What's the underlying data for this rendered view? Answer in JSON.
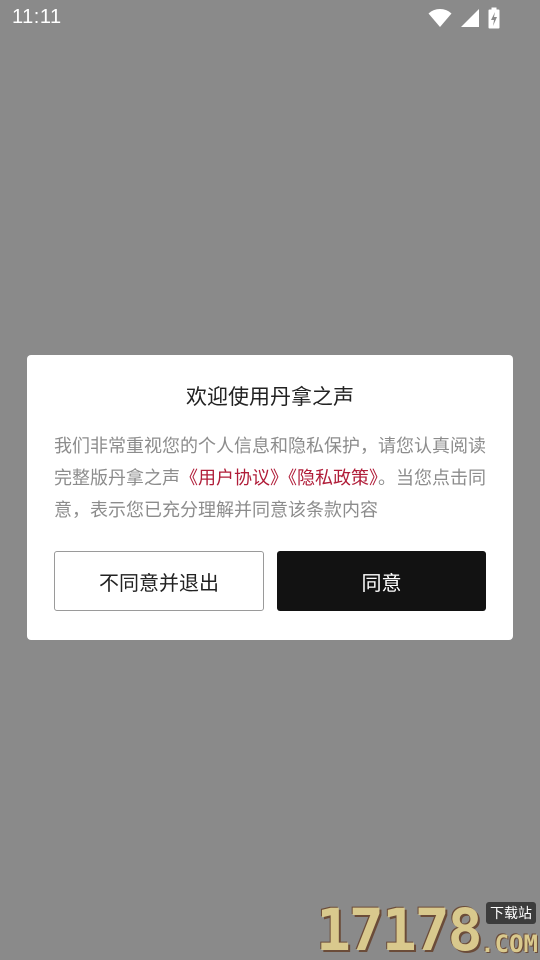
{
  "status_bar": {
    "time": "11:11",
    "icons": [
      "wifi-icon",
      "cellular-signal-icon",
      "battery-charging-icon"
    ]
  },
  "dialog": {
    "title": "欢迎使用丹拿之声",
    "body": {
      "text_before": "我们非常重视您的个人信息和隐私保护，请您认真阅读完整版丹拿之声",
      "link_user_agreement": "《用户协议》",
      "link_privacy_policy": "《隐私政策》",
      "text_after": "。当您点击同意，表示您已充分理解并同意该条款内容"
    },
    "decline_label": "不同意并退出",
    "agree_label": "同意"
  },
  "watermark": {
    "digits": "17178",
    "badge": "下载站",
    "suffix": ".COM"
  },
  "colors": {
    "scrim": "#8a8a8a",
    "link": "#b01c38",
    "agree_button": "#121212",
    "body_text": "#8c8c8c"
  }
}
